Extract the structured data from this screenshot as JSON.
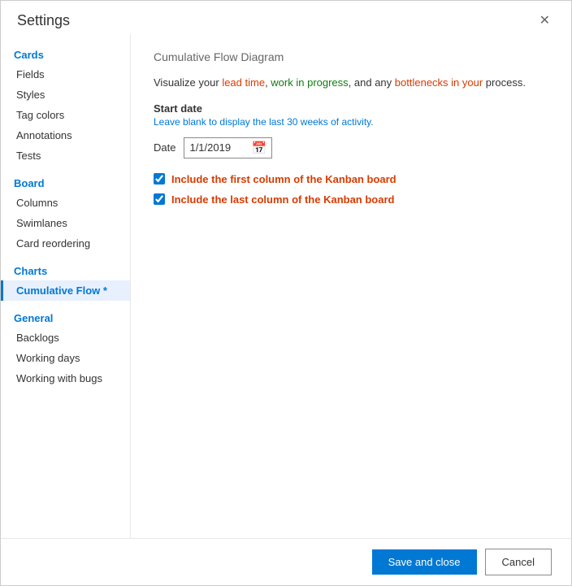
{
  "dialog": {
    "title": "Settings",
    "close_label": "✕"
  },
  "sidebar": {
    "groups": [
      {
        "label": "Cards",
        "items": [
          "Fields",
          "Styles",
          "Tag colors",
          "Annotations",
          "Tests"
        ]
      },
      {
        "label": "Board",
        "items": [
          "Columns",
          "Swimlanes",
          "Card reordering"
        ]
      },
      {
        "label": "Charts",
        "items": [
          "Cumulative Flow *"
        ]
      },
      {
        "label": "General",
        "items": [
          "Backlogs",
          "Working days",
          "Working with bugs"
        ]
      }
    ]
  },
  "main": {
    "section_title": "Cumulative Flow Diagram",
    "description_part1": "Visualize your lead time, work in progress, and any bottlenecks in your process.",
    "start_date_label": "Start date",
    "start_date_hint": "Leave blank to display the last 30 weeks of activity.",
    "date_label": "Date",
    "date_value": "1/1/2019",
    "checkbox1_label": "Include the first column of the Kanban board",
    "checkbox2_label": "Include the last column of the Kanban board"
  },
  "footer": {
    "save_label": "Save and close",
    "cancel_label": "Cancel"
  }
}
